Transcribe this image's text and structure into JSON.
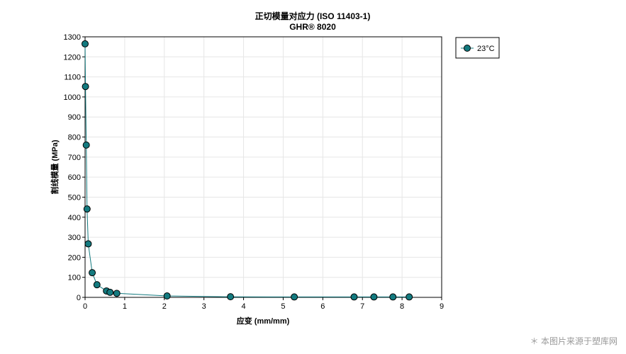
{
  "chart_data": {
    "type": "line",
    "title": "正切模量对应力 (ISO 11403-1)",
    "subtitle": "GHR® 8020",
    "xlabel": "应变 (mm/mm)",
    "ylabel": "割线模量 (MPa)",
    "xlim": [
      0,
      9
    ],
    "ylim": [
      0,
      1300
    ],
    "xticks": [
      0,
      1,
      2,
      3,
      4,
      5,
      6,
      7,
      8,
      9
    ],
    "yticks": [
      0,
      100,
      200,
      300,
      400,
      500,
      600,
      700,
      800,
      900,
      1000,
      1100,
      1200,
      1300
    ],
    "grid": true,
    "legend_position": "right",
    "series": [
      {
        "name": "23°C",
        "color": "#137a7f",
        "x": [
          0.0,
          0.01,
          0.03,
          0.05,
          0.08,
          0.18,
          0.3,
          0.54,
          0.63,
          0.8,
          2.07,
          3.67,
          5.28,
          6.79,
          7.29,
          7.77,
          8.18
        ],
        "y": [
          1265,
          1052,
          760,
          441,
          267,
          123,
          63,
          32,
          25,
          20,
          7,
          3,
          2,
          2,
          2,
          2,
          2
        ]
      }
    ]
  },
  "watermark": "＊ 本图片来源于塑库网"
}
